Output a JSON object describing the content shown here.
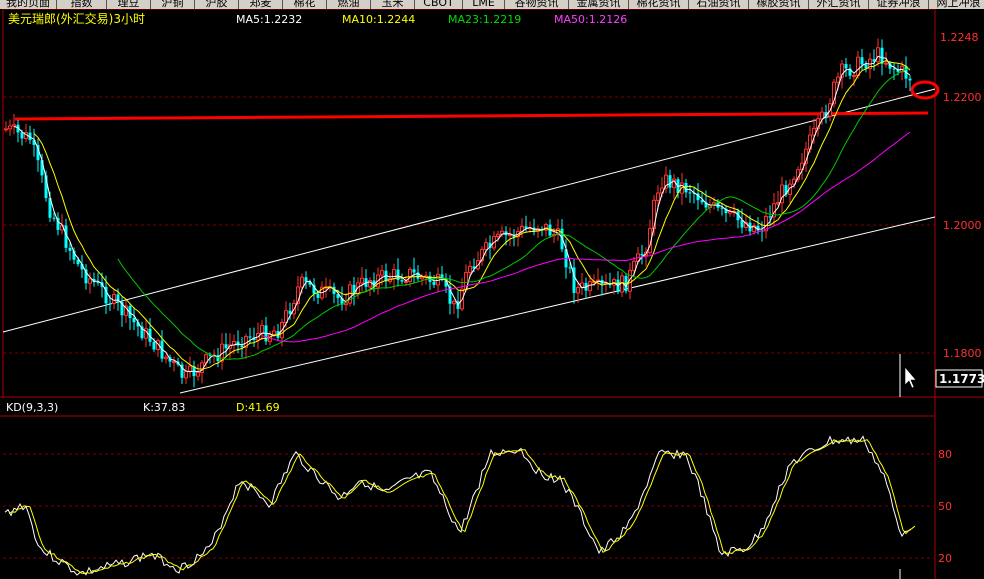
{
  "tabs": [
    {
      "label": "我的页面"
    },
    {
      "label": "指数"
    },
    {
      "label": "理豆"
    },
    {
      "label": "沪铜"
    },
    {
      "label": "沪胶"
    },
    {
      "label": "郑麦"
    },
    {
      "label": "棉花"
    },
    {
      "label": "燃油"
    },
    {
      "label": "玉米"
    },
    {
      "label": "CBOT"
    },
    {
      "label": "LME"
    },
    {
      "label": "谷物资讯"
    },
    {
      "label": "金属资讯"
    },
    {
      "label": "棉花资讯"
    },
    {
      "label": "石油资讯"
    },
    {
      "label": "橡胶资讯"
    },
    {
      "label": "外汇资讯"
    },
    {
      "label": "证券冲浪"
    },
    {
      "label": "网上冲浪"
    }
  ],
  "instrument": "美元瑞郎(外汇交易)3小时",
  "ma": {
    "ma5": "MA5:1.2232",
    "ma10": "MA10:1.2244",
    "ma23": "MA23:1.2219",
    "ma50": "MA50:1.2126"
  },
  "colors": {
    "up": "#ff3030",
    "down": "#00ffff",
    "ma5": "#ffffff",
    "ma10": "#ffff00",
    "ma23": "#00c800",
    "ma50": "#ff00ff",
    "axis": "#c00000",
    "trendline": "#ff0000",
    "channel": "#ffffff",
    "price_box": "#ffffff"
  },
  "price_axis": {
    "ticks": [
      "1.2248",
      "1.2200",
      "1.2000",
      "1.1800"
    ],
    "current_price": "1.1773"
  },
  "kd": {
    "title": "KD(9,3,3)",
    "k": "K:37.83",
    "d": "D:41.69",
    "ticks": [
      "80",
      "50",
      "20"
    ]
  },
  "chart_data": {
    "type": "line",
    "series": [
      {
        "name": "MA5",
        "values": [
          1.2232
        ]
      },
      {
        "name": "MA10",
        "values": [
          1.2244
        ]
      },
      {
        "name": "MA23",
        "values": [
          1.2219
        ]
      },
      {
        "name": "MA50",
        "values": [
          1.2126
        ]
      }
    ],
    "ylim": [
      1.1773,
      1.2248
    ],
    "kd_ylim": [
      20,
      80
    ]
  }
}
